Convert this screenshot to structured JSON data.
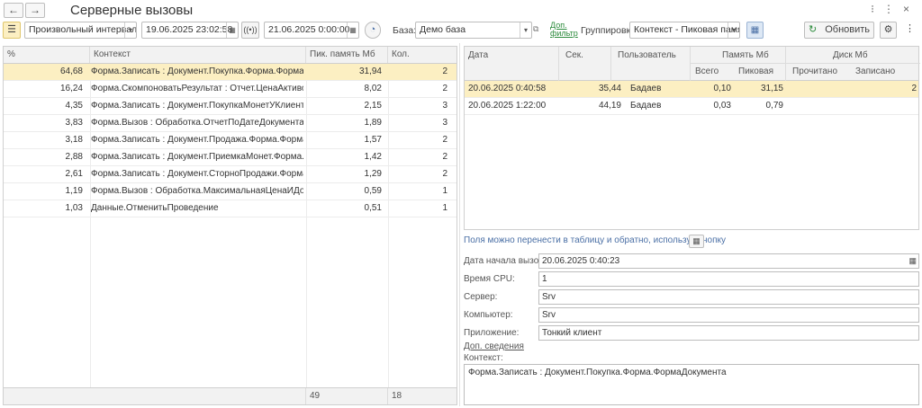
{
  "window": {
    "title": "Серверные вызовы",
    "back_icon": "←",
    "forward_icon": "→"
  },
  "toolbar": {
    "period_value": "Произвольный интервал",
    "date_from": "19.06.2025 23:02:58",
    "date_to": "21.06.2025  0:00:00",
    "base_label": "База:",
    "base_value": "Демо база",
    "extra_filter_line1": "Доп.",
    "extra_filter_line2": "фильтр",
    "grouping_label": "Группировка:",
    "grouping_value": "Контекст - Пиковая память",
    "refresh_label": "Обновить"
  },
  "left_table": {
    "columns": [
      "%",
      "Контекст",
      "Пик. память Мб",
      "Кол."
    ],
    "rows": [
      {
        "pct": "64,68",
        "context": "Форма.Записать : Документ.Покупка.Форма.ФормаДокумента",
        "mem": "31,94",
        "count": "2"
      },
      {
        "pct": "16,24",
        "context": "Форма.СкомпоноватьРезультат : Отчет.ЦенаАктивовПоКонтрагенту",
        "mem": "8,02",
        "count": "2"
      },
      {
        "pct": "4,35",
        "context": "Форма.Записать : Документ.ПокупкаМонетУКлиента.Форма.ФормаДокумента",
        "mem": "2,15",
        "count": "3"
      },
      {
        "pct": "3,83",
        "context": "Форма.Вызов : Обработка.ОтчетПоДатеДокументаПокупки",
        "mem": "1,89",
        "count": "3"
      },
      {
        "pct": "3,18",
        "context": "Форма.Записать : Документ.Продажа.Форма.ФормаДокумента",
        "mem": "1,57",
        "count": "2"
      },
      {
        "pct": "2,88",
        "context": "Форма.Записать : Документ.ПриемкаМонет.Форма.ФормаДокумента",
        "mem": "1,42",
        "count": "2"
      },
      {
        "pct": "2,61",
        "context": "Форма.Записать : Документ.СторноПродажи.Форма.ФормаДокумента",
        "mem": "1,29",
        "count": "2"
      },
      {
        "pct": "1,19",
        "context": "Форма.Вызов : Обработка.МаксимальнаяЦенаИДокументы",
        "mem": "0,59",
        "count": "1"
      },
      {
        "pct": "1,03",
        "context": "Данные.ОтменитьПроведение",
        "mem": "0,51",
        "count": "1"
      }
    ],
    "footer_mem": "49",
    "footer_count": "18"
  },
  "right_table": {
    "headers": {
      "date": "Дата",
      "sec": "Сек.",
      "user": "Пользователь",
      "mem_group": "Память Мб",
      "total": "Всего",
      "peak": "Пиковая",
      "disk_group": "Диск Мб",
      "read": "Прочитано",
      "written": "Записано"
    },
    "rows": [
      {
        "date": "20.06.2025 0:40:58",
        "sec": "35,44",
        "user": "Бадаев",
        "total": "0,10",
        "peak": "31,15",
        "read": "",
        "written": "2"
      },
      {
        "date": "20.06.2025 1:22:00",
        "sec": "44,19",
        "user": "Бадаев",
        "total": "0,03",
        "peak": "0,79",
        "read": "",
        "written": ""
      }
    ]
  },
  "details": {
    "hint": "Поля можно перенести в таблицу и обратно, используя кнопку",
    "start_label": "Дата начала вызова:",
    "start_value": "20.06.2025  0:40:23",
    "cpu_label": "Время CPU:",
    "cpu_value": "1",
    "server_label": "Сервер:",
    "server_value": "Srv",
    "computer_label": "Компьютер:",
    "computer_value": "Srv",
    "app_label": "Приложение:",
    "app_value": "Тонкий клиент",
    "more_link": "Доп. сведения",
    "context_label": "Контекст:",
    "context_value": "Форма.Записать : Документ.Покупка.Форма.ФормаДокумента"
  }
}
